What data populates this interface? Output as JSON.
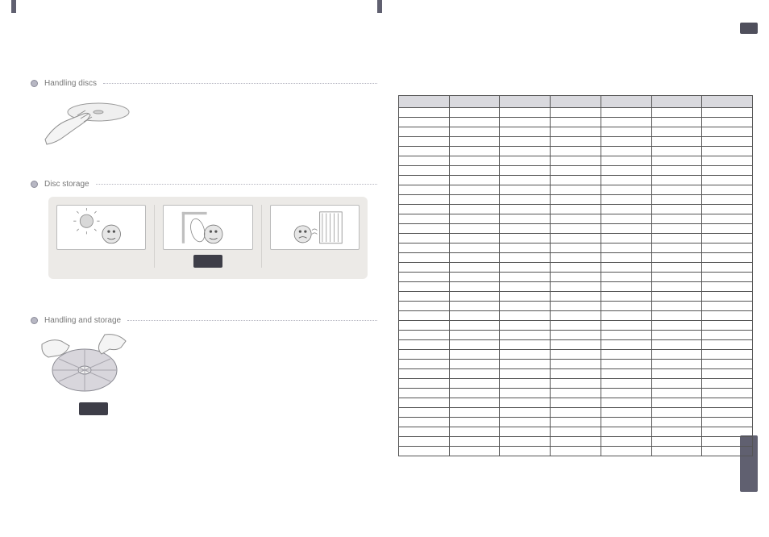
{
  "left": {
    "sections": [
      {
        "title": "Handling discs"
      },
      {
        "title": "Disc storage"
      },
      {
        "title": "Handling and storage"
      }
    ],
    "storage": {
      "cells": [
        "sun",
        "lean",
        "heater"
      ]
    }
  },
  "right": {
    "headers": [
      "",
      "",
      "",
      "",
      "",
      "",
      ""
    ],
    "rows": 36
  }
}
